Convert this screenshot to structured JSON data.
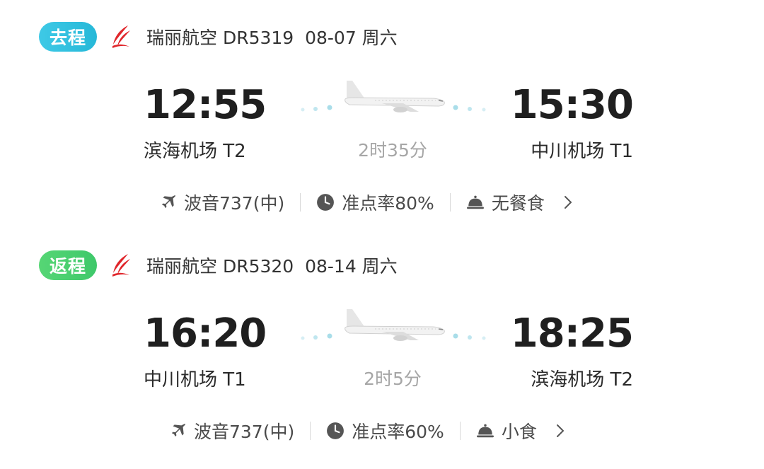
{
  "outbound": {
    "badge": "去程",
    "flight": "瑞丽航空 DR5319  08-07 周六",
    "dep_time": "12:55",
    "arr_time": "15:30",
    "dep_airport": "滨海机场 T2",
    "arr_airport": "中川机场 T1",
    "duration": "2时35分",
    "aircraft": "波音737(中)",
    "ontime": "准点率80%",
    "meal": "无餐食"
  },
  "return": {
    "badge": "返程",
    "flight": "瑞丽航空 DR5320  08-14 周六",
    "dep_time": "16:20",
    "arr_time": "18:25",
    "dep_airport": "中川机场 T1",
    "arr_airport": "滨海机场 T2",
    "duration": "2时5分",
    "aircraft": "波音737(中)",
    "ontime": "准点率60%",
    "meal": "小食"
  },
  "colors": {
    "outbound_badge": "#26b8d8",
    "return_badge": "#3ec86a",
    "logo_red": "#e0262b"
  },
  "icons": [
    "ruili-airline-logo",
    "airplane-graphic",
    "airplane-icon",
    "clock-icon",
    "meal-cloche-icon",
    "chevron-right-icon"
  ]
}
